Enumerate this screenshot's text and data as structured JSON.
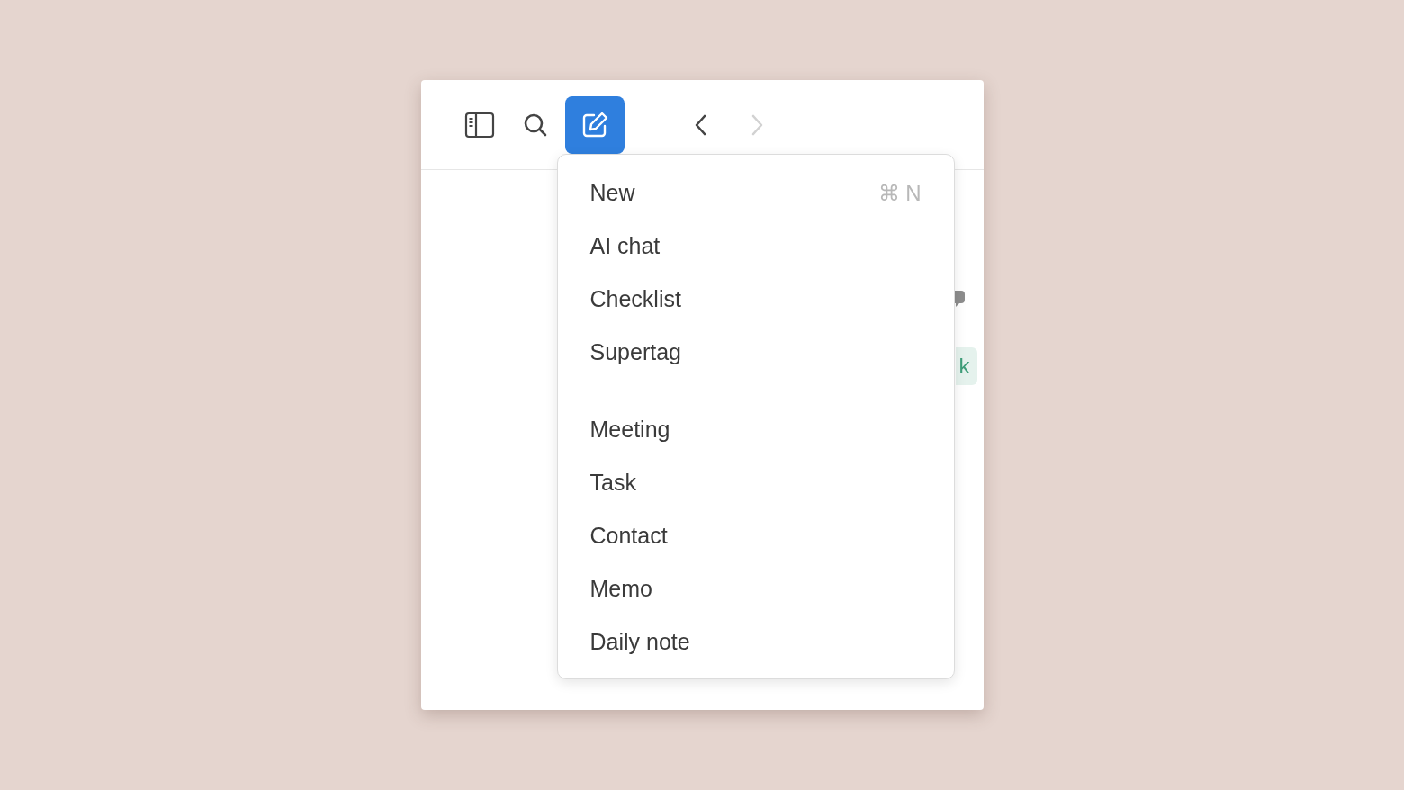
{
  "toolbar": {
    "buttons": [
      {
        "kind": "sidebar",
        "selected": false,
        "disabled": false
      },
      {
        "kind": "search",
        "selected": false,
        "disabled": false
      },
      {
        "kind": "compose",
        "selected": true,
        "disabled": false
      },
      {
        "kind": "back",
        "selected": false,
        "disabled": false
      },
      {
        "kind": "forward",
        "selected": false,
        "disabled": true
      }
    ]
  },
  "content": {
    "tag": {
      "label": "k",
      "color": "#3f9e7a"
    }
  },
  "menu": {
    "sections": [
      {
        "items": [
          {
            "label": "New",
            "shortcut": "⌘ N"
          },
          {
            "label": "AI chat"
          },
          {
            "label": "Checklist"
          },
          {
            "label": "Supertag"
          }
        ]
      },
      {
        "items": [
          {
            "label": "Meeting"
          },
          {
            "label": "Task"
          },
          {
            "label": "Contact"
          },
          {
            "label": "Memo"
          },
          {
            "label": "Daily note"
          }
        ]
      }
    ]
  }
}
